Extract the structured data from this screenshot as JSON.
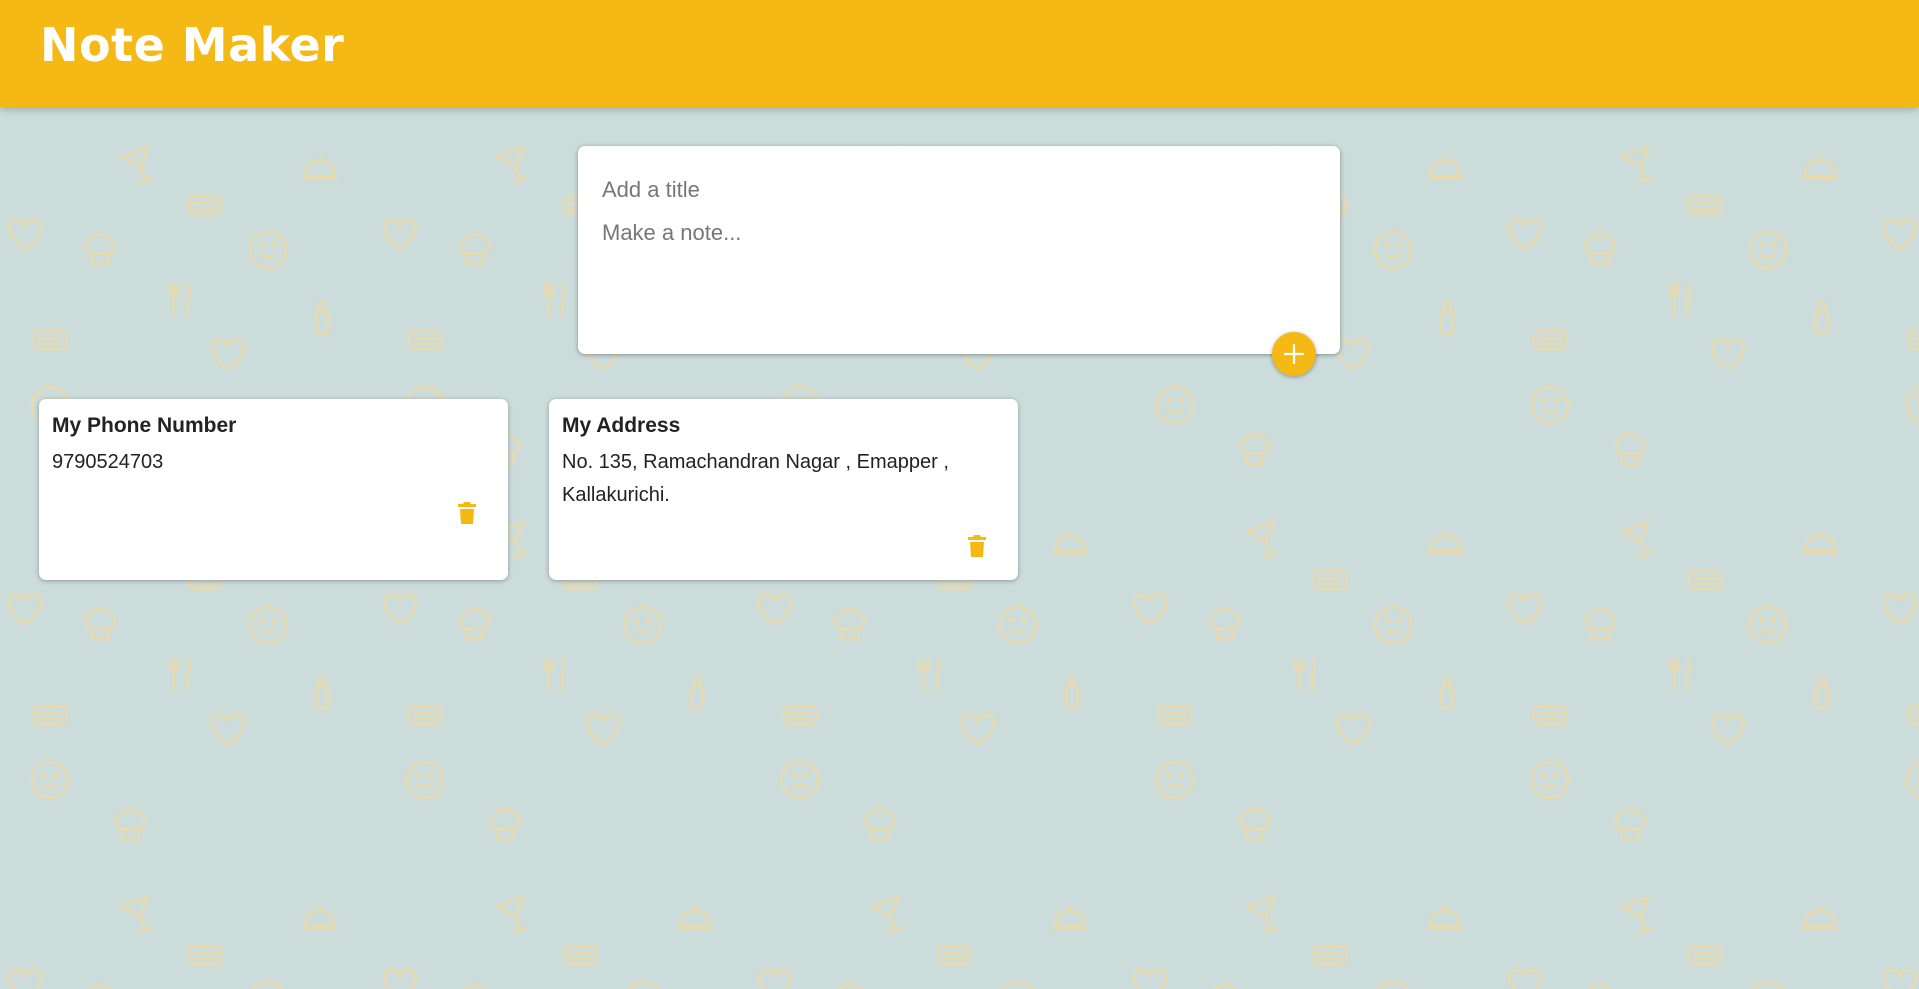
{
  "header": {
    "title": "Note Maker"
  },
  "create_area": {
    "title_placeholder": "Add a title",
    "content_placeholder": "Make a note...",
    "add_button_icon": "plus-icon"
  },
  "notes": [
    {
      "title": "My Phone Number",
      "content": "9790524703",
      "delete_icon": "trash-icon"
    },
    {
      "title": "My Address",
      "content": "No. 135, Ramachandran Nagar , Emapper , Kallakurichi.",
      "delete_icon": "trash-icon"
    }
  ],
  "colors": {
    "accent": "#f4b914",
    "background": "#cbdcdb",
    "pattern": "#ecd9a6"
  }
}
